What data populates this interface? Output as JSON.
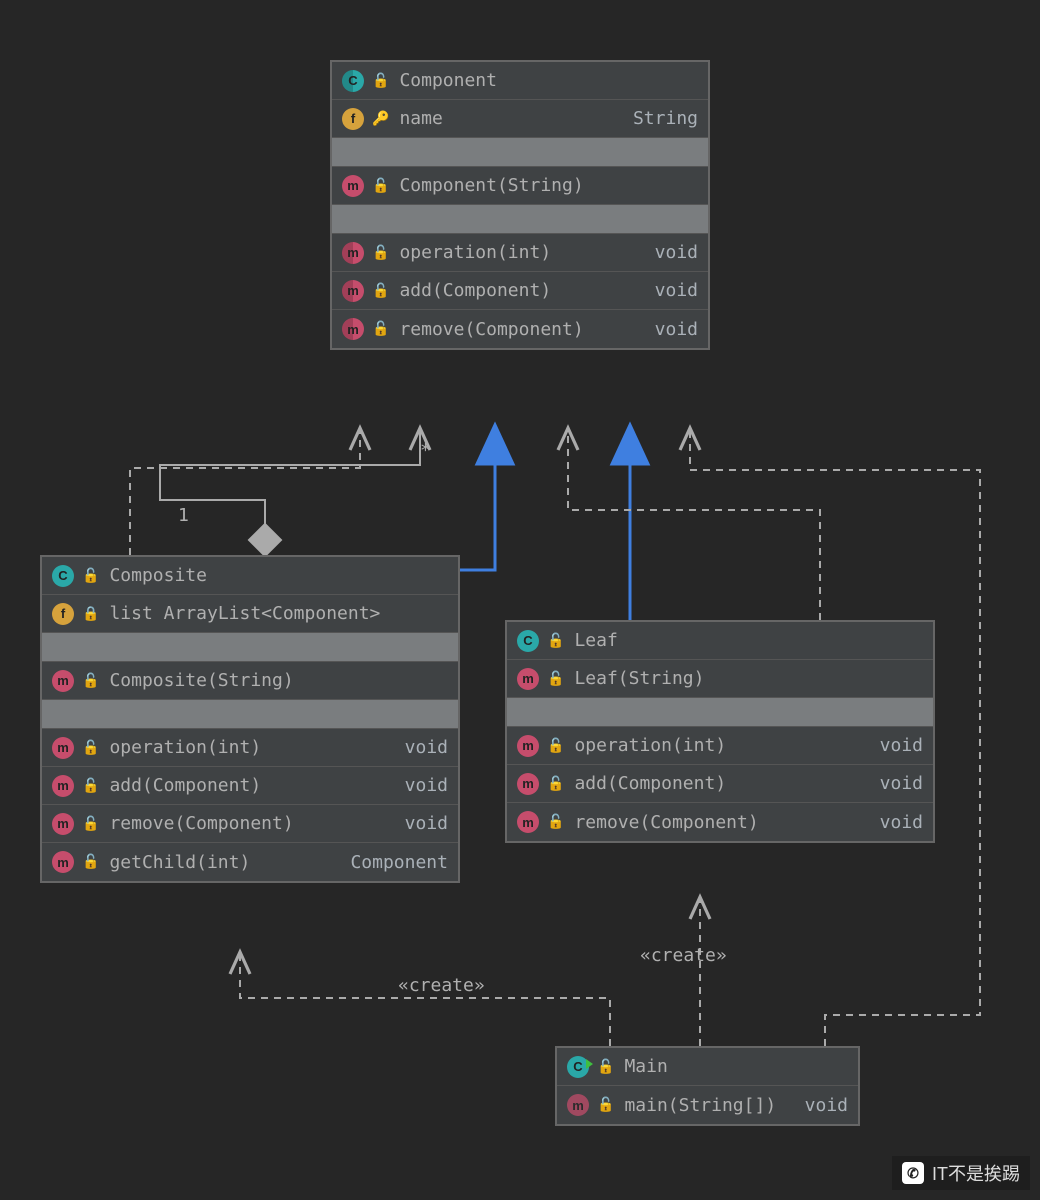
{
  "classes": {
    "component": {
      "name": "Component",
      "fields": [
        {
          "name": "name",
          "type": "String",
          "icon": "f",
          "access": "key"
        }
      ],
      "ctors": [
        {
          "sig": "Component(String)",
          "icon": "m",
          "access": "green"
        }
      ],
      "methods": [
        {
          "sig": "operation(int)",
          "ret": "void",
          "icon": "m-ring",
          "access": "green"
        },
        {
          "sig": "add(Component)",
          "ret": "void",
          "icon": "m-ring",
          "access": "green"
        },
        {
          "sig": "remove(Component)",
          "ret": "void",
          "icon": "m-ring",
          "access": "green"
        }
      ]
    },
    "composite": {
      "name": "Composite",
      "fields": [
        {
          "name": "list",
          "type": "ArrayList<Component>",
          "icon": "f",
          "access": "orange"
        }
      ],
      "ctors": [
        {
          "sig": "Composite(String)",
          "icon": "m",
          "access": "green"
        }
      ],
      "methods": [
        {
          "sig": "operation(int)",
          "ret": "void",
          "icon": "m",
          "access": "green"
        },
        {
          "sig": "add(Component)",
          "ret": "void",
          "icon": "m",
          "access": "green"
        },
        {
          "sig": "remove(Component)",
          "ret": "void",
          "icon": "m",
          "access": "green"
        },
        {
          "sig": "getChild(int)",
          "ret": "Component",
          "icon": "m",
          "access": "green"
        }
      ]
    },
    "leaf": {
      "name": "Leaf",
      "ctors": [
        {
          "sig": "Leaf(String)",
          "icon": "m",
          "access": "green"
        }
      ],
      "methods": [
        {
          "sig": "operation(int)",
          "ret": "void",
          "icon": "m",
          "access": "green"
        },
        {
          "sig": "add(Component)",
          "ret": "void",
          "icon": "m",
          "access": "green"
        },
        {
          "sig": "remove(Component)",
          "ret": "void",
          "icon": "m",
          "access": "green"
        }
      ]
    },
    "main": {
      "name": "Main",
      "methods": [
        {
          "sig": "main(String[])",
          "ret": "void",
          "icon": "m-dim",
          "access": "green"
        }
      ]
    }
  },
  "relations": {
    "aggregation_1": "1",
    "aggregation_star": "*",
    "create_leaf": "«create»",
    "create_composite": "«create»"
  },
  "watermark": "IT不是挨踢"
}
